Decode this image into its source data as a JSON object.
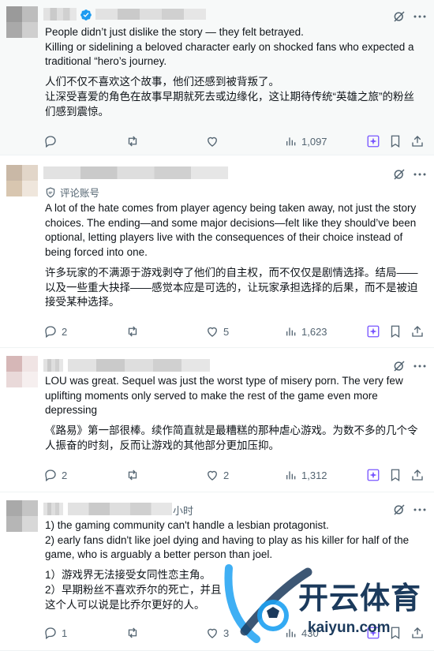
{
  "posts": [
    {
      "badge": "",
      "time": "",
      "text_en": [
        "People didn’t just dislike the story — they felt betrayed.",
        "Killing or sidelining a beloved character early on shocked fans who expected a traditional “hero’s journey."
      ],
      "text_zh": [
        "人们不仅不喜欢这个故事，他们还感到被背叛了。",
        "让深受喜爱的角色在故事早期就死去或边缘化，这让期待传统“英雄之旅”的粉丝们感到震惊。"
      ],
      "replies": "",
      "reposts": "",
      "likes": "",
      "views": "1,097"
    },
    {
      "badge": "评论账号",
      "time": "",
      "text_en": [
        "A lot of the hate comes from player agency being taken away, not just the story choices. The ending—and some major decisions—felt like they should’ve been optional, letting players live with the consequences of their choice instead of being forced into one."
      ],
      "text_zh": [
        "许多玩家的不满源于游戏剥夺了他们的自主权，而不仅仅是剧情选择。结局——以及一些重大抉择——感觉本应是可选的，让玩家承担选择的后果，而不是被迫接受某种选择。"
      ],
      "replies": "2",
      "reposts": "",
      "likes": "5",
      "views": "1,623"
    },
    {
      "badge": "",
      "time": "",
      "text_en": [
        "LOU was great. Sequel was just the worst type of misery porn. The very few uplifting moments only served to make the rest of the game even more depressing"
      ],
      "text_zh": [
        "《路易》第一部很棒。续作简直就是最糟糕的那种虐心游戏。为数不多的几个令人振奋的时刻，反而让游戏的其他部分更加压抑。"
      ],
      "replies": "2",
      "reposts": "",
      "likes": "2",
      "views": "1,312"
    },
    {
      "badge": "",
      "time": "小时",
      "text_en": [
        "1) the gaming community can't handle a lesbian protagonist.",
        "2) early fans didn't like joel dying and having to play as his killer for half of the game, who is arguably a better person than joel."
      ],
      "text_zh": [
        "1）游戏界无法接受女同性恋主角。",
        "2）早期粉丝不喜欢乔尔的死亡，并且",
        "这个人可以说是比乔尔更好的人。"
      ],
      "replies": "1",
      "reposts": "",
      "likes": "3",
      "views": "430"
    }
  ],
  "watermark": {
    "brand_cn": "开云体育",
    "brand_url": "kaiyun.com"
  },
  "colors": {
    "text": "#0f1419",
    "muted": "#536471",
    "accent": "#1d9bf0",
    "grok": "#7856ff"
  }
}
